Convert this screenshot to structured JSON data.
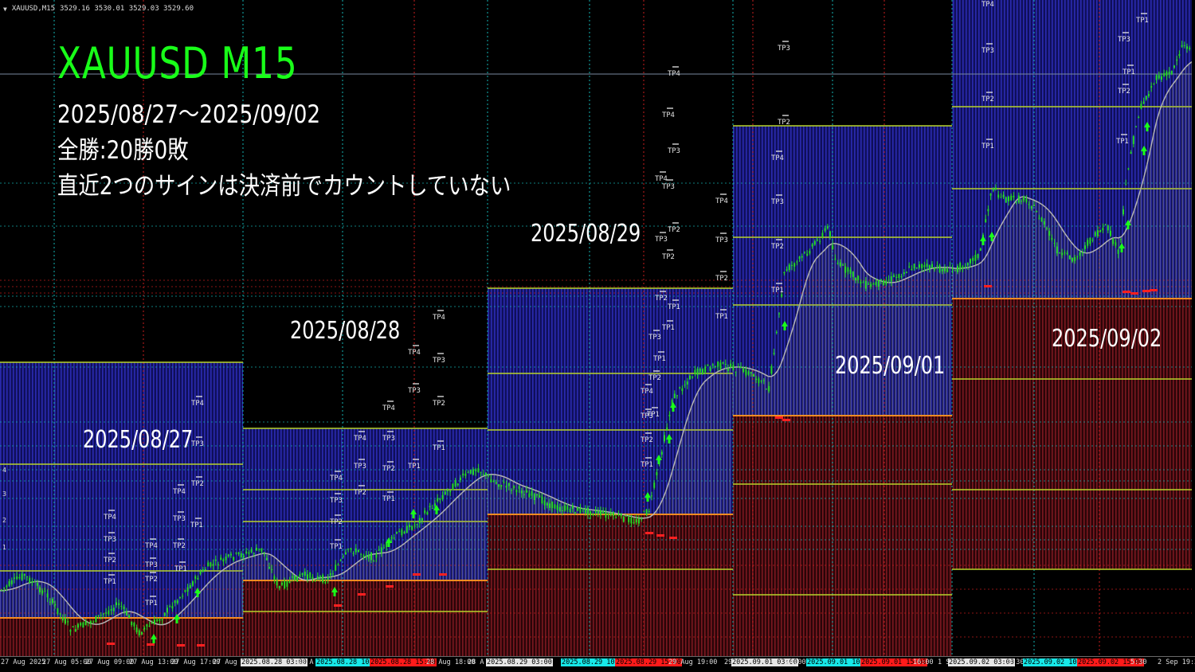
{
  "window": {
    "symbol_info": "XAUUSD,M15",
    "ohlc": "3529.16 3530.01 3529.03 3529.60"
  },
  "overlay": {
    "title": "XAUUSD  M15",
    "lines": [
      "2025/08/27～2025/09/02",
      "全勝:20勝0敗",
      "直近2つのサインは決済前でカウントしていない"
    ]
  },
  "day_labels": [
    "2025/08/27",
    "2025/08/28",
    "2025/08/29",
    "2025/09/01",
    "2025/09/02"
  ],
  "tp_labels": [
    "TP1",
    "TP2",
    "TP3",
    "TP4"
  ],
  "axis_left_markers": [
    "4",
    "3",
    "2",
    "1"
  ],
  "time_axis": [
    {
      "text": "27 Aug 2025",
      "style": ""
    },
    {
      "text": "27 Aug 05:00",
      "style": ""
    },
    {
      "text": "27 Aug 09:00",
      "style": ""
    },
    {
      "text": "27 Aug 13:00",
      "style": ""
    },
    {
      "text": "27 Aug 17:00",
      "style": ""
    },
    {
      "text": "27 Aug 2",
      "style": ""
    },
    {
      "text": "2025.08.28 03:00",
      "style": "hl-white"
    },
    {
      "text": "28 A",
      "style": ""
    },
    {
      "text": "2025.08.28 10:00",
      "style": "hl-cyan"
    },
    {
      "text": "2025.08.28 15:00",
      "style": "hl-red"
    },
    {
      "text": "28 Aug 18:00",
      "style": ""
    },
    {
      "text": "28 A",
      "style": ""
    },
    {
      "text": "2025.08.29 03:00",
      "style": "hl-white"
    },
    {
      "text": "2025.08.29 10:00",
      "style": "hl-cyan"
    },
    {
      "text": "2025.08.29 15:00",
      "style": "hl-red"
    },
    {
      "text": "29 Aug 19:00",
      "style": ""
    },
    {
      "text": "29",
      "style": ""
    },
    {
      "text": "2025.09.01 03:00",
      "style": "hl-white"
    },
    {
      "text": "04:00",
      "style": ""
    },
    {
      "text": "2025.09.01 10:00",
      "style": "hl-cyan"
    },
    {
      "text": "2025.09.01 15:00",
      "style": "hl-red"
    },
    {
      "text": "16:00",
      "style": ""
    },
    {
      "text": "1 Se",
      "style": ""
    },
    {
      "text": "2025.09.02 03:00",
      "style": "hl-white"
    },
    {
      "text": "3:30",
      "style": ""
    },
    {
      "text": "2025.09.02 10:00",
      "style": "hl-cyan"
    },
    {
      "text": "2025.09.02 15:00",
      "style": "hl-red"
    },
    {
      "text": "5:30",
      "style": ""
    },
    {
      "text": "2 Sep 19:30",
      "style": ""
    }
  ],
  "colors": {
    "background": "#000000",
    "buy_zone": "#1e1e8c",
    "sell_zone": "#5a0f14",
    "candle": "#23d923",
    "moving_average": "#b4b4b4",
    "level_line": "#b8d42a",
    "entry_line": "#ff8c1a",
    "stop_marker": "#ff2020",
    "grid_cyan": "#14b4b4",
    "grid_red": "#c81e1e",
    "title_green": "#19ff19"
  }
}
